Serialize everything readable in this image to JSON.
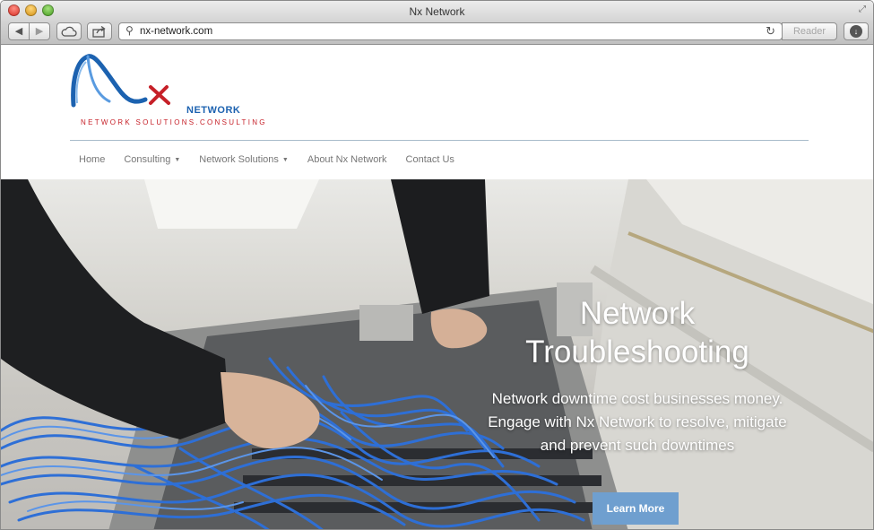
{
  "browser": {
    "window_title": "Nx Network",
    "url": "nx-network.com",
    "reader_label": "Reader"
  },
  "logo": {
    "wordmark": "NETWORK",
    "tagline": "NETWORK SOLUTIONS.CONSULTING"
  },
  "nav": {
    "items": [
      {
        "label": "Home"
      },
      {
        "label": "Consulting",
        "has_dropdown": true
      },
      {
        "label": "Network Solutions",
        "has_dropdown": true
      },
      {
        "label": "About Nx Network"
      },
      {
        "label": "Contact Us"
      }
    ]
  },
  "hero": {
    "title_line1": "Network",
    "title_line2": "Troubleshooting",
    "description": "Network downtime cost businesses money. Engage with Nx Network to resolve, mitigate and prevent such downtimes",
    "cta_label": "Learn More"
  },
  "colors": {
    "brand_blue": "#1c62b0",
    "brand_red": "#c62028",
    "cta": "#6f9fcf",
    "cable": "#2e6fd6"
  }
}
